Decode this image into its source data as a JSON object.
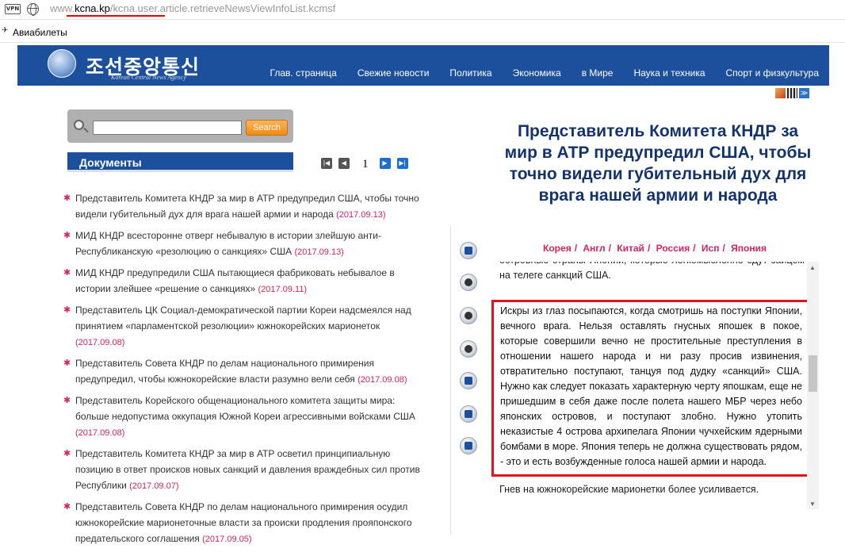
{
  "browser": {
    "url_prefix": "www.",
    "url_domain": "kcna.kp",
    "url_path": "/kcna.user.article.retrieveNewsViewInfoList.kcmsf",
    "vpn_label": "VPN",
    "bookmark": "Авиабилеты"
  },
  "header": {
    "logo_korean": "조선중앙통신",
    "logo_english": "Korean Central News Agency",
    "nav": [
      "Глав. страница",
      "Свежие новости",
      "Политика",
      "Экономика",
      "в Мире",
      "Наука и техника",
      "Спорт и физкультура"
    ]
  },
  "search": {
    "button": "Search",
    "value": ""
  },
  "documents": {
    "heading": "Документы",
    "page": "1",
    "items": [
      {
        "text": "Представитель Комитета КНДР за мир в АТР предупредил США, чтобы точно видели губительный дух для врага нашей армии и народа",
        "date": "(2017.09.13)"
      },
      {
        "text": "МИД КНДР всесторонне отверг небывалую в истории злейшую анти-Республиканскую «резолюцию о санкциях» США",
        "date": "(2017.09.13)"
      },
      {
        "text": "МИД КНДР предупредили США пытающиеся фабриковать небывалое в истории злейшее «решение о санкциях»",
        "date": "(2017.09.11)"
      },
      {
        "text": "Представитель ЦК Социал-демократической партии Кореи надсмеялся над принятием «парламентской резолюции» южнокорейских марионеток",
        "date": "(2017.09.08)"
      },
      {
        "text": "Представитель Совета КНДР по делам национального примирения предупредил, чтобы южнокорейские власти разумно вели себя",
        "date": "(2017.09.08)"
      },
      {
        "text": "Представитель Корейского общенационального комитета защиты мира: больше недопустима оккупация Южной Кореи агрессивными войсками США",
        "date": "(2017.09.08)"
      },
      {
        "text": "Представитель Комитета КНДР за мир в АТР осветил принципиальную позицию в ответ происков новых санкций и давления враждебных сил против Республики",
        "date": "(2017.09.07)"
      },
      {
        "text": "Представитель Совета КНДР по делам национального примирения осудил южнокорейские марионеточные власти за происки продления прояпонского предательского соглашения",
        "date": "(2017.09.05)"
      }
    ]
  },
  "article": {
    "title": "Представитель Комитета КНДР за мир в АТР предупредил США, чтобы точно видели губительный дух для врага нашей армии и народа",
    "languages": [
      "Корея",
      "Англ",
      "Китай",
      "Россия",
      "Исп",
      "Япония"
    ],
    "para_top": "островные страны Японии, которые легкомысленно едут зайцем на телеге санкций США.",
    "para_highlight": "Искры из глаз посыпаются, когда смотришь на поступки Японии, вечного врага. Нельзя оставлять гнусных япошек в покое, которые совершили вечно не простительные преступления в отношении нашего народа и ни разу просив извинения, отвратительно поступают, танцуя под дудку «санкций» США. Нужно как следует показать характерную черту япошкам, еще не пришедшим в себя даже после полета нашего МБР через небо японских островов, и поступают злобно. Нужно утопить неказистые 4 острова архипелага Японии чучхейским ядерными бомбами в море. Япония теперь не должна существовать рядом, - это и есть возбужденные голоса нашей армии и народа.",
    "para_after": "Гнев на южнокорейские марионетки более усиливается."
  },
  "colors": {
    "banner": "#1c4f9c",
    "accent": "#d6245b",
    "title": "#13336b",
    "highlight_border": "#e0141e"
  },
  "icons": [
    "globe-icon",
    "vpn-icon",
    "magnifier-icon",
    "first-page-icon",
    "prev-page-icon",
    "next-page-icon",
    "last-page-icon"
  ]
}
